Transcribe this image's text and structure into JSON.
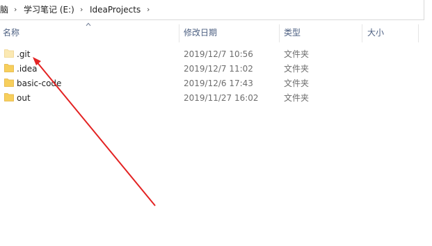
{
  "breadcrumb": {
    "items": [
      {
        "label": "脑"
      },
      {
        "label": "学习笔记 (E:)"
      },
      {
        "label": "IdeaProjects"
      }
    ]
  },
  "columns": {
    "name": "名称",
    "modified": "修改日期",
    "type": "类型",
    "size": "大小"
  },
  "rows": [
    {
      "name": ".git",
      "modified": "2019/12/7 10:56",
      "type": "文件夹"
    },
    {
      "name": ".idea",
      "modified": "2019/12/7 11:02",
      "type": "文件夹"
    },
    {
      "name": "basic-code",
      "modified": "2019/12/6 17:43",
      "type": "文件夹"
    },
    {
      "name": "out",
      "modified": "2019/11/27 16:02",
      "type": "文件夹"
    }
  ],
  "icons": {
    "sort": "sort-up-icon",
    "folder": "folder-icon",
    "separator": "chevron-right-icon"
  },
  "colors": {
    "folder": "#f7cf5c",
    "folder_faded": "#fbe9b3",
    "annotation_arrow": "#e32222",
    "header_text": "#4d6082"
  }
}
